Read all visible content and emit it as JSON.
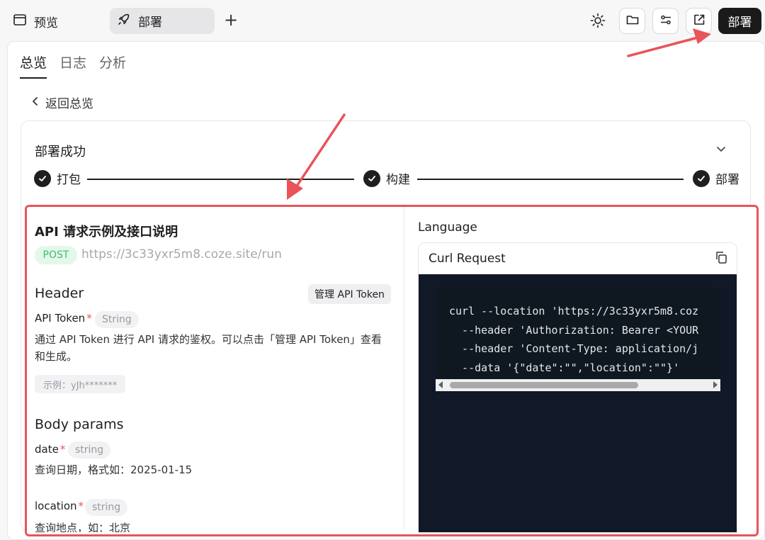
{
  "topbar": {
    "preview_label": "预览",
    "deploy_tab_label": "部署",
    "add_label": "+",
    "deploy_button_label": "部署",
    "icons": [
      "preview-icon",
      "rocket-icon",
      "sun-icon",
      "folder-icon",
      "settings-sliders-icon",
      "external-link-icon"
    ]
  },
  "tabs": [
    {
      "label": "总览",
      "active": true
    },
    {
      "label": "日志",
      "active": false
    },
    {
      "label": "分析",
      "active": false
    }
  ],
  "back_label": "返回总览",
  "deploy_status": {
    "title": "部署成功",
    "steps": [
      {
        "label": "打包"
      },
      {
        "label": "构建"
      },
      {
        "label": "部署"
      }
    ]
  },
  "api": {
    "title": "API 请求示例及接口说明",
    "method": "POST",
    "url": "https://3c33yxr5m8.coze.site/run",
    "header_heading": "Header",
    "manage_token_label": "管理 API Token",
    "header_param": {
      "name": "API Token",
      "required": "*",
      "type": "String",
      "description_line1": "通过 API Token 进行 API 请求的鉴权。可以点击「管理 API Token」查看",
      "description_line2": "和生成。",
      "example": "示例：yJh*******"
    },
    "body_heading": "Body params",
    "body_params": [
      {
        "name": "date",
        "required": "*",
        "type": "string",
        "description": "查询日期，格式如：2025-01-15"
      },
      {
        "name": "location",
        "required": "*",
        "type": "string",
        "description": "查询地点，如：北京"
      }
    ]
  },
  "code": {
    "language_label": "Language",
    "request_label": "Curl Request",
    "lines": [
      "curl --location 'https://3c33yxr5m8.coz",
      "  --header 'Authorization: Bearer <YOUR",
      "  --header 'Content-Type: application/j",
      "  --data '{\"date\":\"\",\"location\":\"\"}'"
    ]
  },
  "colors": {
    "highlight_border": "#e9545a",
    "code_background": "#111827",
    "post_badge": "#3fbf6d",
    "primary_button": "#1a1a1a"
  }
}
